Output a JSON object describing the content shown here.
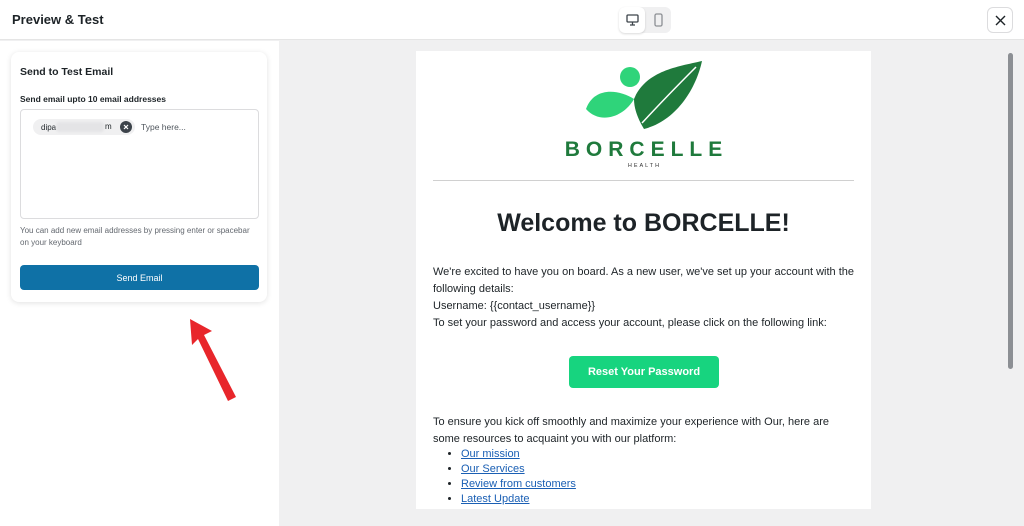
{
  "header": {
    "title": "Preview & Test"
  },
  "device_toggle": {
    "desktop_icon": "desktop-icon",
    "mobile_icon": "mobile-icon",
    "selected": "desktop"
  },
  "close_icon": "close-icon",
  "test_email_card": {
    "title": "Send to Test Email",
    "field_label": "Send email upto 10 email addresses",
    "chip_prefix": "dipa",
    "chip_suffix": "m",
    "input_placeholder": "Type here...",
    "hint": "You can add new email addresses by pressing enter or spacebar on your keyboard",
    "send_button": "Send Email"
  },
  "email_preview": {
    "brand_name": "BORCELLE",
    "brand_sub": "HEALTH",
    "heading": "Welcome to BORCELLE!",
    "paragraph1": "We're excited to have you on board. As a new user, we've set up your account with the following details:",
    "username_line": "Username: {{contact_username}}",
    "password_line": "To set your password and access your account, please click on the following link:",
    "reset_button": "Reset Your Password",
    "paragraph2": "To ensure you kick off smoothly and maximize your experience with Our, here are some resources to acquaint you with our platform:",
    "links": [
      "Our mission",
      "Our Services",
      "Review from customers",
      "Latest Update"
    ]
  },
  "colors": {
    "primary_button": "#0f71a6",
    "reset_button": "#17d47f",
    "brand_green": "#1f7a3c",
    "arrow": "#e8262b"
  }
}
